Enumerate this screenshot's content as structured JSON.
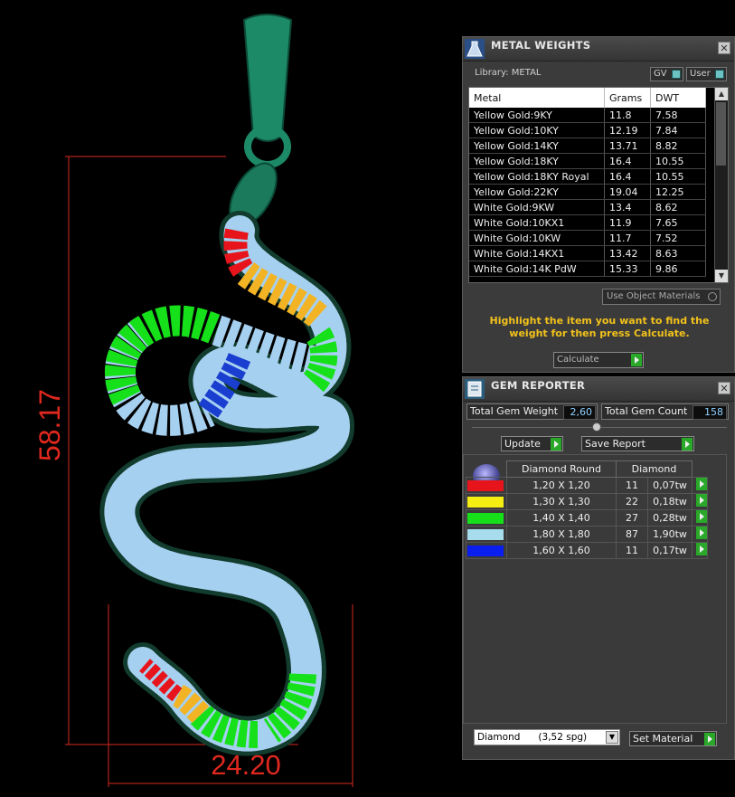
{
  "viewport": {
    "dimension_vertical": "58.17",
    "dimension_horizontal": "24.20"
  },
  "metal_weights": {
    "title": "METAL WEIGHTS",
    "close_icon": "close-icon",
    "library_label": "Library: METAL",
    "gv_label": "GV",
    "user_label": "User",
    "columns": [
      "Metal",
      "Grams",
      "DWT"
    ],
    "rows": [
      [
        "Yellow Gold:9KY",
        "11.8",
        "7.58"
      ],
      [
        "Yellow Gold:10KY",
        "12.19",
        "7.84"
      ],
      [
        "Yellow Gold:14KY",
        "13.71",
        "8.82"
      ],
      [
        "Yellow Gold:18KY",
        "16.4",
        "10.55"
      ],
      [
        "Yellow Gold:18KY Royal",
        "16.4",
        "10.55"
      ],
      [
        "Yellow Gold:22KY",
        "19.04",
        "12.25"
      ],
      [
        "White Gold:9KW",
        "13.4",
        "8.62"
      ],
      [
        "White Gold:10KX1",
        "11.9",
        "7.65"
      ],
      [
        "White Gold:10KW",
        "11.7",
        "7.52"
      ],
      [
        "White Gold:14KX1",
        "13.42",
        "8.63"
      ],
      [
        "White Gold:14K PdW",
        "15.33",
        "9.86"
      ]
    ],
    "use_object_materials": "Use Object Materials",
    "hint": "Highlight the item you want to find the weight for then press Calculate.",
    "calculate_label": "Calculate"
  },
  "gem_reporter": {
    "title": "GEM REPORTER",
    "total_weight_label": "Total Gem Weight",
    "total_weight_value": "2,60",
    "total_count_label": "Total Gem Count",
    "total_count_value": "158",
    "update_label": "Update",
    "save_report_label": "Save Report",
    "header_shape": "Diamond Round",
    "header_material": "Diamond",
    "gems": [
      {
        "color": "#e8141c",
        "size": "1,20 X 1,20",
        "count": "11",
        "weight": "0,07tw"
      },
      {
        "color": "#f4ee12",
        "size": "1,30 X 1,30",
        "count": "22",
        "weight": "0,18tw"
      },
      {
        "color": "#16e01a",
        "size": "1,40 X 1,40",
        "count": "27",
        "weight": "0,28tw"
      },
      {
        "color": "#a6dcec",
        "size": "1,80 X 1,80",
        "count": "87",
        "weight": "1,90tw"
      },
      {
        "color": "#0a1ef0",
        "size": "1,60 X 1,60",
        "count": "11",
        "weight": "0,17tw"
      }
    ],
    "material_select": "Diamond      (3,52 spg)",
    "set_material_label": "Set Material"
  }
}
